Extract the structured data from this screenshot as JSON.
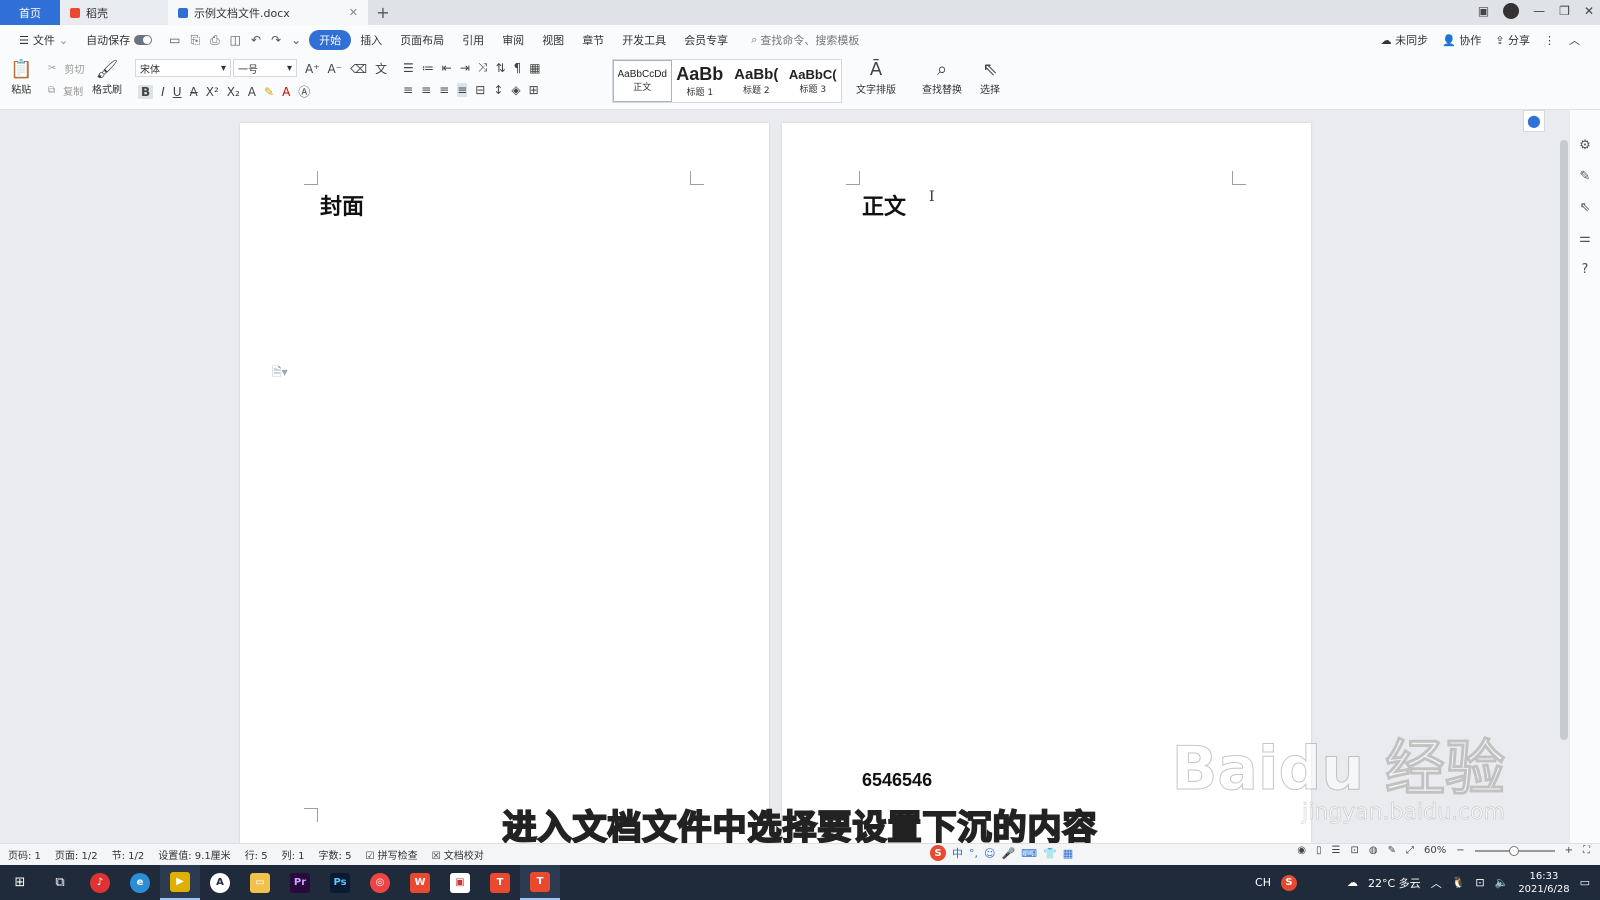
{
  "tabs": {
    "home": "首页",
    "shell": "稻壳",
    "document": "示例文档文件.docx",
    "new_tab": "+"
  },
  "menu": {
    "file": "文件",
    "autosave": "自动保存",
    "items": [
      "开始",
      "插入",
      "页面布局",
      "引用",
      "审阅",
      "视图",
      "章节",
      "开发工具",
      "会员专享"
    ],
    "search_placeholder": "查找命令、搜索模板",
    "unsynced": "未同步",
    "collaborate": "协作",
    "share": "分享"
  },
  "ribbon": {
    "paste": "粘贴",
    "cut": "剪切",
    "copy": "复制",
    "format_painter": "格式刷",
    "font_name": "宋体",
    "font_size": "一号",
    "styles": [
      {
        "sample": "AaBbCcDd",
        "label": "正文"
      },
      {
        "sample": "AaBb",
        "label": "标题 1"
      },
      {
        "sample": "AaBb(",
        "label": "标题 2"
      },
      {
        "sample": "AaBbC(",
        "label": "标题 3"
      }
    ],
    "text_layout": "文字排版",
    "find_replace": "查找替换",
    "select": "选择"
  },
  "document": {
    "left_page_heading": "封面",
    "right_page_heading": "正文",
    "page_number": "6546546"
  },
  "overlay": {
    "subtitle": "进入文档文件中选择要设置下沉的内容",
    "watermark": "Baidu 经验",
    "watermark_url": "jingyan.baidu.com"
  },
  "statusbar": {
    "page_code": "页码: 1",
    "page_count": "页面: 1/2",
    "section": "节: 1/2",
    "setting": "设置值: 9.1厘米",
    "row": "行: 5",
    "column": "列: 1",
    "word_count": "字数: 5",
    "spell_check": "拼写检查",
    "doc_proofread": "文档校对",
    "zoom": "60%"
  },
  "taskbar": {
    "language": "CH",
    "weather": "22°C 多云",
    "time": "16:33",
    "date": "2021/6/28"
  },
  "colors": {
    "accent": "#2f6fd6",
    "taskbar": "#1f2a3a"
  }
}
